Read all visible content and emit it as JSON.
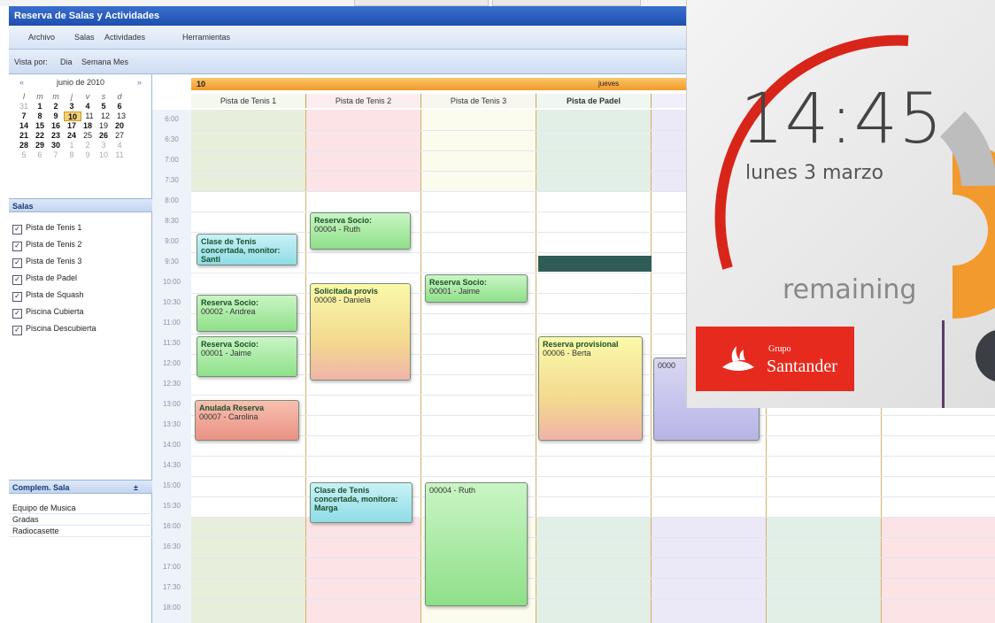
{
  "app": {
    "title": "Reserva de Salas y Actividades",
    "menu": [
      "Archivo",
      "Salas",
      "Actividades",
      "Herramientas"
    ],
    "view_by": {
      "label": "Vista por:",
      "options": [
        "Dia",
        "Semana",
        "Mes"
      ]
    }
  },
  "mini_calendar": {
    "month_label": "junio de 2010",
    "prev": "«",
    "next": "»",
    "dow": [
      "l",
      "m",
      "m",
      "j",
      "v",
      "s",
      "d"
    ],
    "rows": [
      [
        "31",
        "1",
        "2",
        "3",
        "4",
        "5",
        "6"
      ],
      [
        "7",
        "8",
        "9",
        "10",
        "11",
        "12",
        "13"
      ],
      [
        "14",
        "15",
        "16",
        "17",
        "18",
        "19",
        "20"
      ],
      [
        "21",
        "22",
        "23",
        "24",
        "25",
        "26",
        "27"
      ],
      [
        "28",
        "29",
        "30",
        "1",
        "2",
        "3",
        "4"
      ],
      [
        "5",
        "6",
        "7",
        "8",
        "9",
        "10",
        "11"
      ]
    ]
  },
  "salas": {
    "header": "Salas",
    "items": [
      "Pista de Tenis 1",
      "Pista de Tenis 2",
      "Pista de Tenis 3",
      "Pista de Padel",
      "Pista de Squash",
      "Piscina Cubierta",
      "Piscina Descubierta"
    ]
  },
  "complementos": {
    "header": "Complem. Sala",
    "toggle": "±",
    "items": [
      "Equipo de Musica",
      "Gradas",
      "Radiocasette"
    ]
  },
  "schedule": {
    "day_number": "10",
    "day_name": "jueves",
    "columns": [
      "Pista de Tenis 1",
      "Pista de Tenis 2",
      "Pista de Tenis 3",
      "Pista de Padel",
      "Pi"
    ],
    "times": [
      "6:00",
      "6:30",
      "7:00",
      "7:30",
      "8:00",
      "8:30",
      "9:00",
      "9:30",
      "10:00",
      "10:30",
      "11:00",
      "11:30",
      "12:00",
      "12:30",
      "13:00",
      "13:30",
      "14:00",
      "14:30",
      "15:00",
      "15:30",
      "16:00",
      "16:30",
      "17:00",
      "17:30",
      "18:00"
    ],
    "appointments": [
      {
        "title": "Clase de Tenis concertada, monitor: Santi",
        "sub": ""
      },
      {
        "title": "Reserva Socio:",
        "sub": "00004 - Ruth"
      },
      {
        "title": "Reserva Socio:",
        "sub": "00002 - Andrea"
      },
      {
        "title": "Solicitada provis",
        "sub": "00008 - Daniela"
      },
      {
        "title": "Reserva Socio:",
        "sub": "00001 - Jaime"
      },
      {
        "title": "Reserva Socio:",
        "sub": "00001 - Jaime"
      },
      {
        "title": "Reserva provisional",
        "sub": "00006 - Berta"
      },
      {
        "title": "",
        "sub": "0000"
      },
      {
        "title": "Anulada Reserva",
        "sub": "00007 - Carolina"
      },
      {
        "title": "Clase de Tenis concertada, monitora: Marga",
        "sub": ""
      },
      {
        "title": "",
        "sub": "00004 - Ruth"
      }
    ]
  },
  "overlay": {
    "time": "14:45",
    "date": "lunes 3 marzo",
    "remaining": "remaining",
    "bank_group": "Grupo",
    "bank_name": "Santander",
    "colors": {
      "ring": "#d8251a",
      "orange": "#f39a2e",
      "brand": "#e62b1e"
    }
  }
}
